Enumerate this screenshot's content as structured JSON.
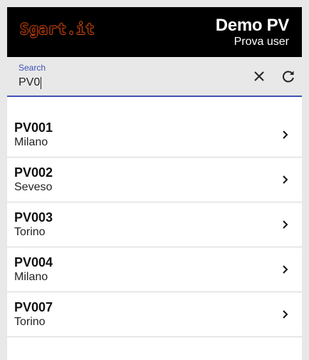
{
  "header": {
    "logo_text": "Sgart.it",
    "title": "Demo PV",
    "subtitle": "Prova user"
  },
  "search": {
    "label": "Search",
    "value": "PV0",
    "clear_icon": "close-icon",
    "refresh_icon": "refresh-icon"
  },
  "items": [
    {
      "code": "PV001",
      "city": "Milano"
    },
    {
      "code": "PV002",
      "city": "Seveso"
    },
    {
      "code": "PV003",
      "city": "Torino"
    },
    {
      "code": "PV004",
      "city": "Milano"
    },
    {
      "code": "PV007",
      "city": "Torino"
    }
  ],
  "colors": {
    "header_bg": "#000000",
    "accent": "#3f51b5",
    "logo": "#d14a10"
  }
}
